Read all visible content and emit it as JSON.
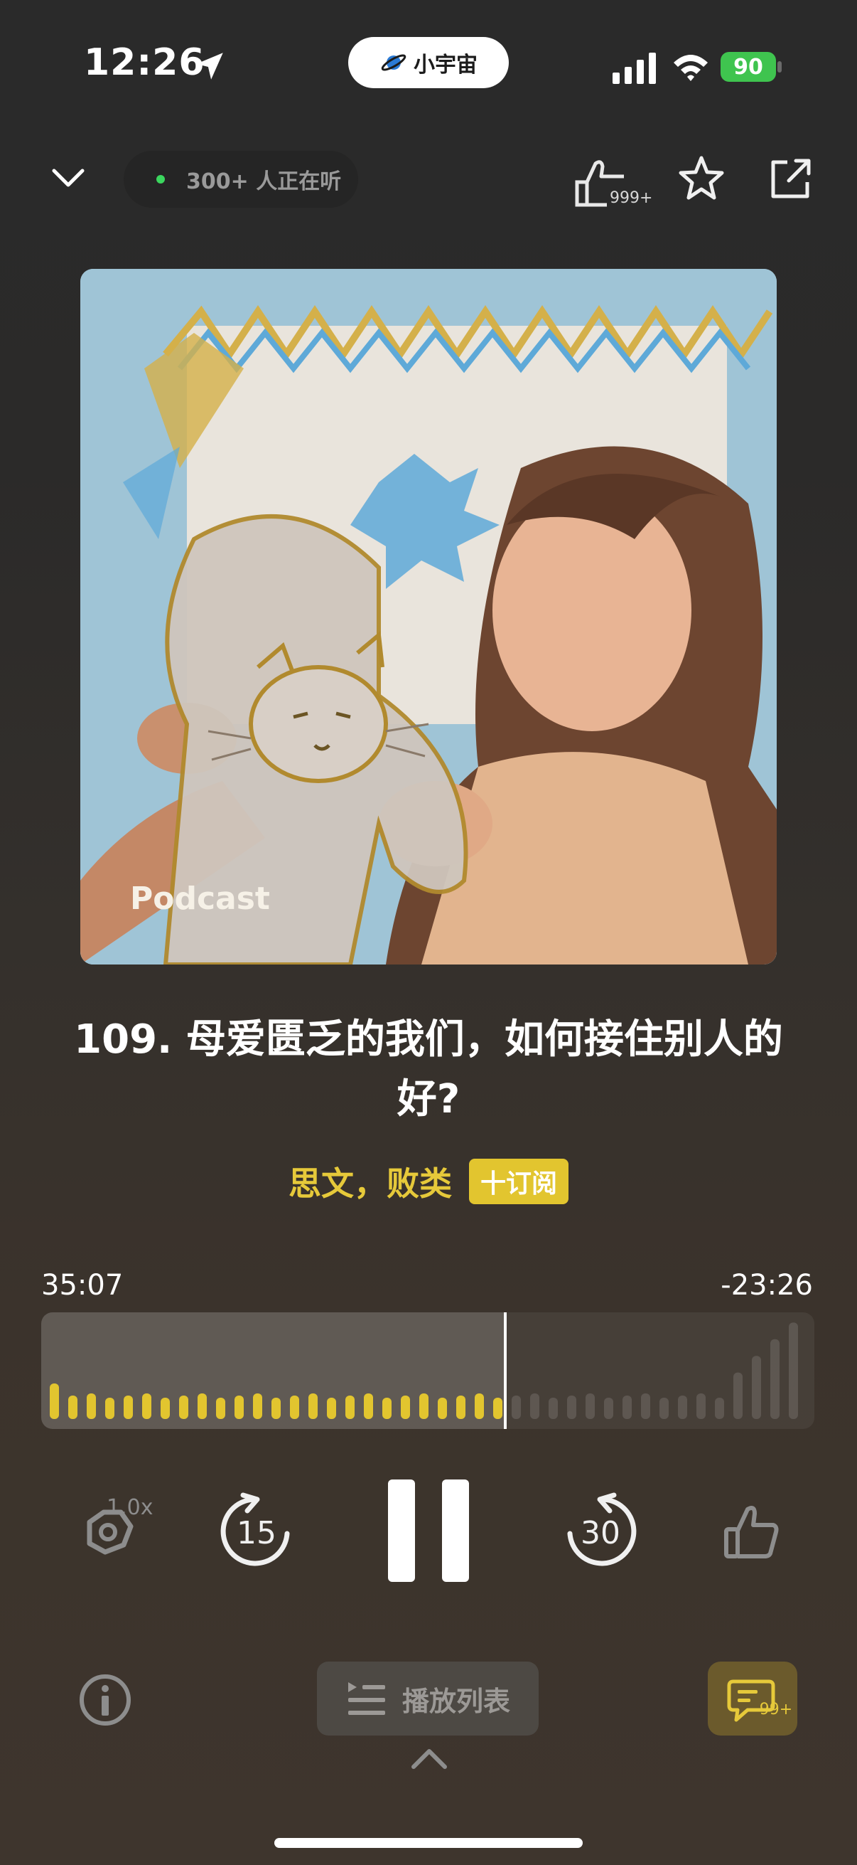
{
  "status_bar": {
    "time": "12:26",
    "app_pill": "小宇宙",
    "battery": "90"
  },
  "header": {
    "listeners": "300+ 人正在听",
    "like_count": "999+"
  },
  "cover": {
    "text": "Podcast"
  },
  "episode": {
    "title": "109. 母爱匮乏的我们，如何接住别人的好?",
    "authors": "思文，败类",
    "subscribe_label": "十订阅"
  },
  "progress": {
    "elapsed": "35:07",
    "remaining": "-23:26",
    "fraction_played": 0.6
  },
  "controls": {
    "speed": "1.0x",
    "skip_back": "15",
    "skip_forward": "30"
  },
  "bottom": {
    "playlist_label": "播放列表",
    "comment_count": "99+"
  },
  "colors": {
    "accent": "#e2c52f",
    "author": "#e6c93a",
    "live_dot": "#3bd65e",
    "battery": "#3fc44f"
  }
}
